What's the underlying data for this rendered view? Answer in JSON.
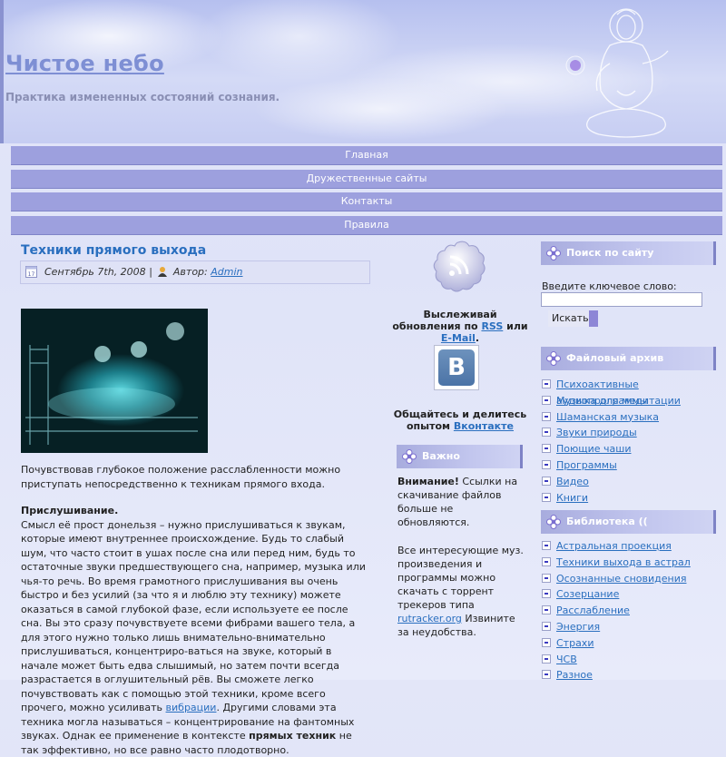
{
  "site": {
    "title": "Чистое небо",
    "description": "Практика измененных состояний сознания."
  },
  "nav": [
    "Главная",
    "Дружественные сайты",
    "Контакты",
    "Правила"
  ],
  "post": {
    "title": "Техники прямого выхода",
    "date": "Сентябрь 7th, 2008",
    "separator": "|",
    "author_label": "Автор:",
    "author": "Admin",
    "intro": "Почувствовав глубокое положение расслабленности можно приступать непосредственно к техникам прямого входа.",
    "section_heading": "Прислушивание.",
    "section_text_1": "Смысл её прост донельзя – нужно прислушиваться к звукам, которые имеют внутреннее происхождение. Будь то слабый шум, что часто стоит в ушах после сна или перед ним, будь то остаточные звуки предшествующего сна, например, музыка или чья-то речь. Во время грамотного прислушивания вы очень быстро и без усилий (за что я и люблю эту технику) можете оказаться в самой глубокой фазе, если используете ее после сна. Вы это сразу почувствуете всеми фибрами вашего тела, а для этого нужно только лишь внимательно-внимательно прислушиваться, концентриро-ваться на звуке, который в начале может быть едва слышимый, но затем почти всегда разрастается в оглушительный рёв. Вы сможете легко почувствовать как с помощью этой техники, кроме всего прочего, можно усиливать",
    "section_link": "вибрации",
    "section_text_2": ". Другими словами эта техника могла называться – концентрирование на фантомных звуках. Однак ее применение в контексте",
    "section_bold": "прямых техник",
    "section_text_3": "не так эффективно, но все равно часто плодотворно."
  },
  "middle": {
    "rss_text_1": "Выслеживай обновления по",
    "rss_link": "RSS",
    "rss_or": "или",
    "email_link": "E-Mail",
    "rss_dot": ".",
    "vk_letter": "B",
    "vk_text_1": "Общайтесь и делитесь опытом",
    "vk_link": "Вконтакте",
    "widget_title": "Важно",
    "note_bold": "Внимание!",
    "note_text": "Ссылки на скачивание файлов больше не обновляются.",
    "note2_text_1": "Все интересующие муз. произведения и программы можно скачать с торрент трекеров типа",
    "note2_link": "rutracker.org",
    "note2_text_2": "Извините за неудобства."
  },
  "sidebar": {
    "search_title": "Поиск по сайту",
    "search_label": "Введите ключевое слово:",
    "search_value": "",
    "search_button": "Искать",
    "archive_title": "Файловый архив",
    "archive_items": [
      "Психоактивные аудиопрограммы",
      "Музыка для медитации",
      "Шаманская музыка",
      "Звуки природы",
      "Поющие чаши",
      "Программы",
      "Видео",
      "Книги"
    ],
    "library_title": "Библиотека ((",
    "library_items": [
      "Астральная проекция",
      "Техники выхода в астрал",
      "Осознанные сновидения",
      "Созерцание",
      "Расслабление",
      "Энергия",
      "Страхи",
      "ЧСВ",
      "Разное"
    ]
  },
  "colors": {
    "accent": "#2a6fbf",
    "nav": "#9da0de",
    "title": "#7e8fd4"
  }
}
